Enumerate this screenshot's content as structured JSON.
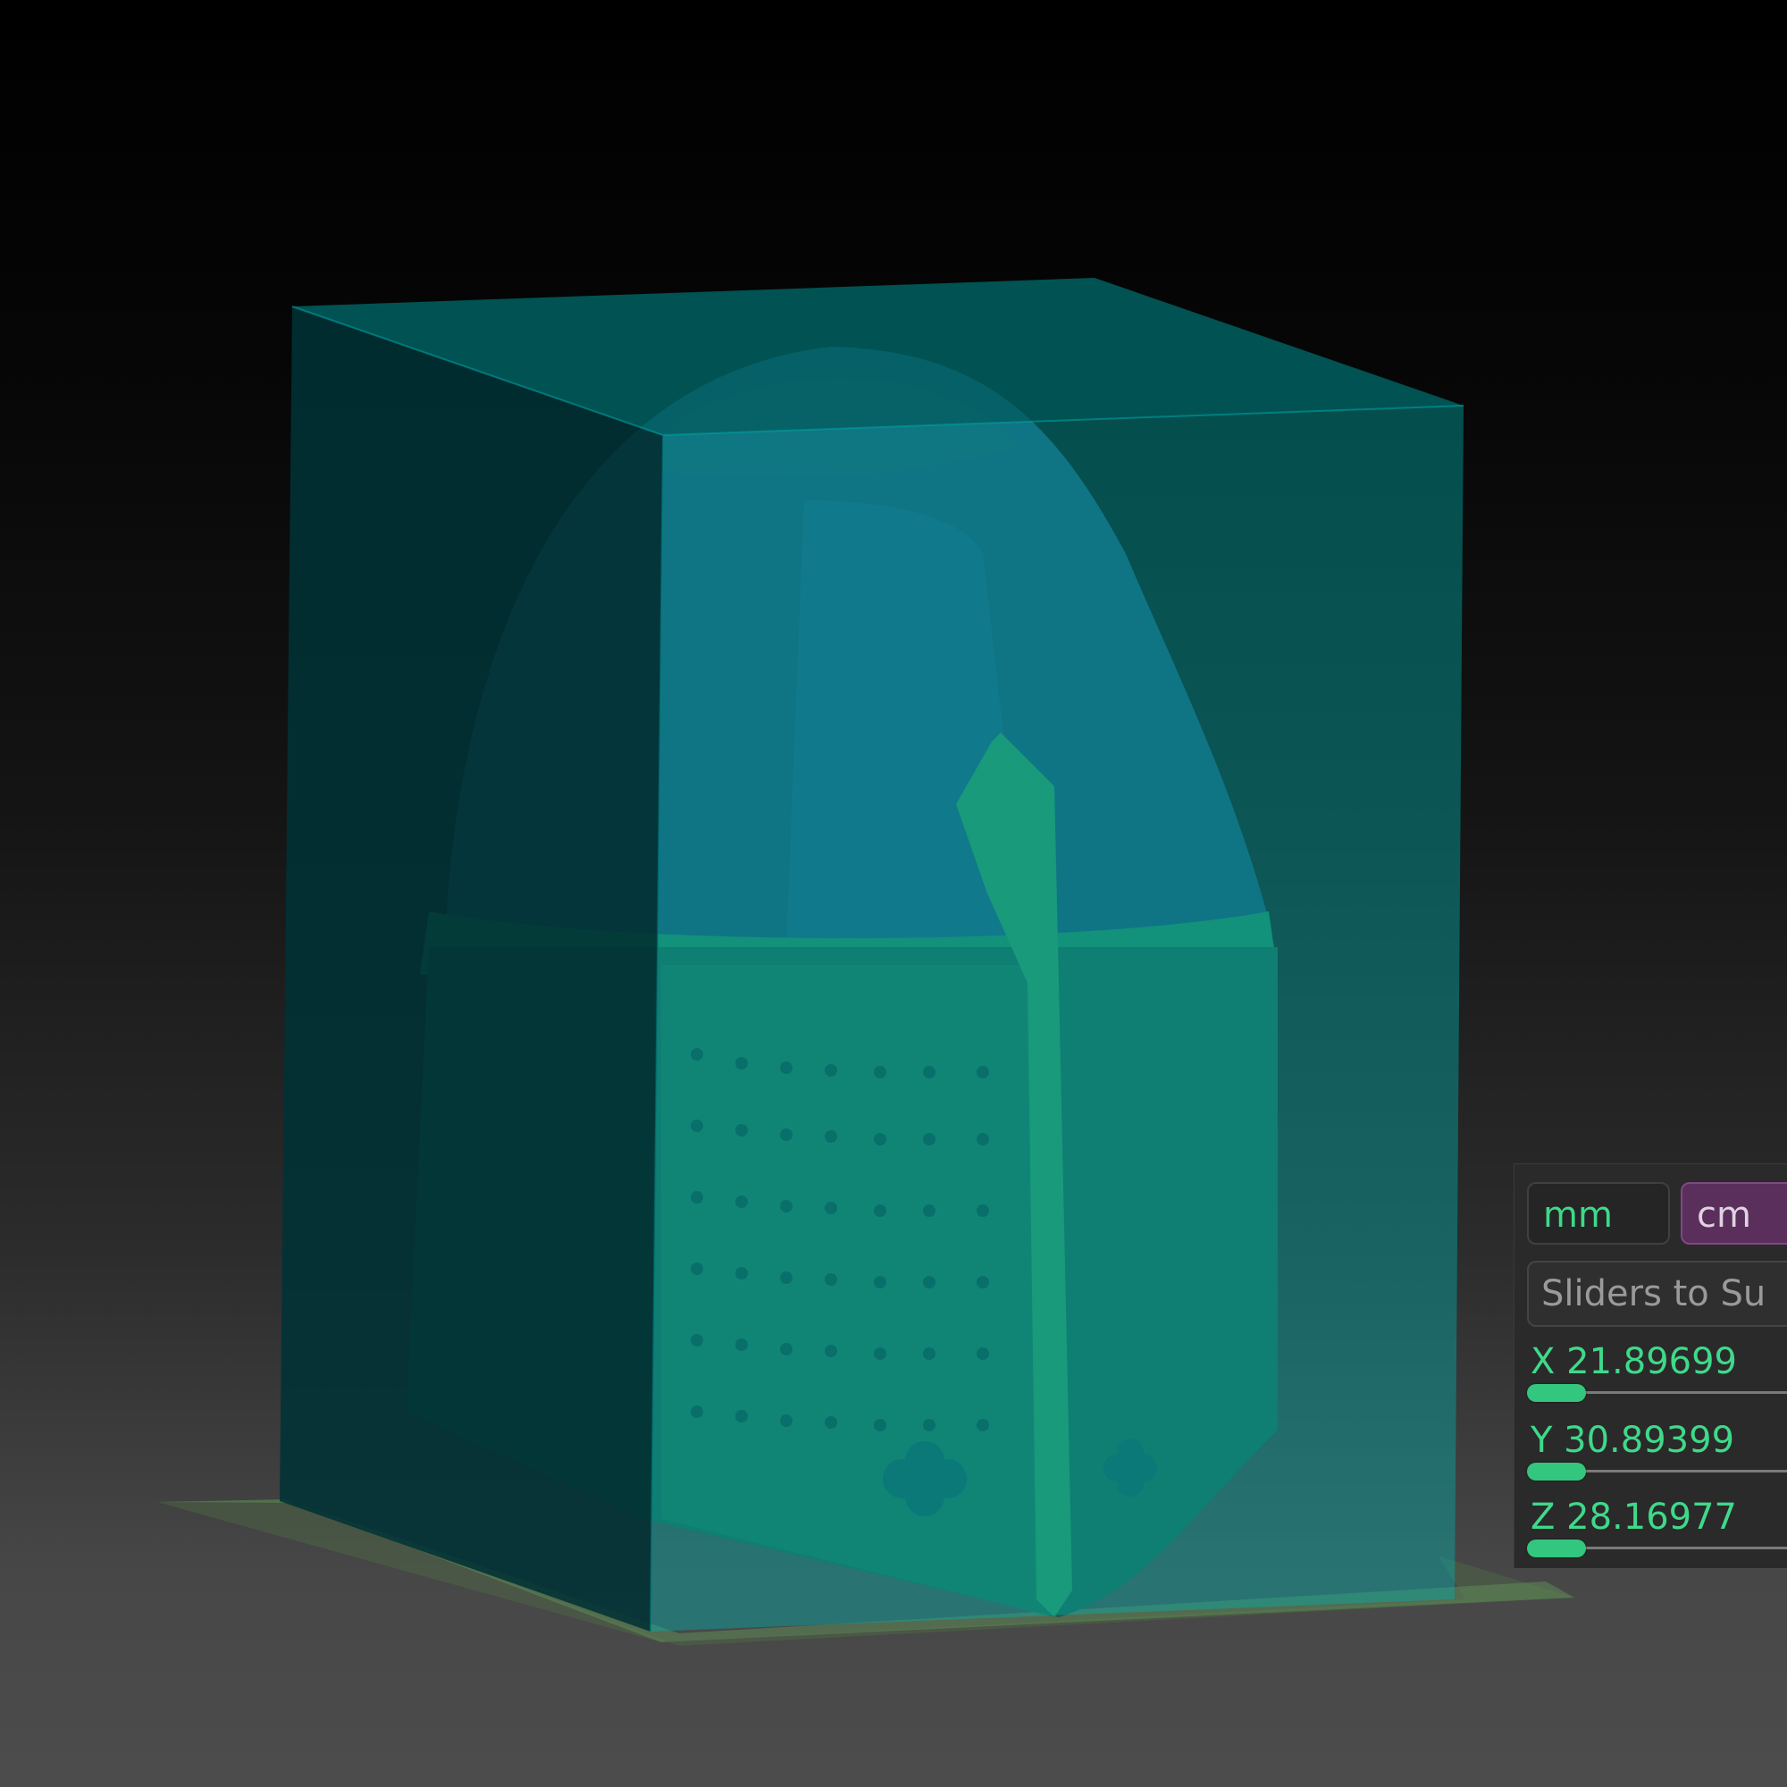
{
  "viewport": {
    "background_top": "#000000",
    "background_bottom": "#4c4c4c",
    "bounding_box_color": "#00a8a8",
    "model_color": "#1f6b4a",
    "floor_grid_color": "#5d8a55"
  },
  "unit_panel": {
    "units": {
      "mm_label": "mm",
      "cm_label": "cm",
      "selected": "cm"
    },
    "sliders_button_label": "Sliders to Su",
    "axes": [
      {
        "axis": "X",
        "value": "21.89699"
      },
      {
        "axis": "Y",
        "value": "30.89399"
      },
      {
        "axis": "Z",
        "value": "28.16977"
      }
    ],
    "accent_color": "#3fd98a",
    "selected_color": "#5a2f5c"
  }
}
